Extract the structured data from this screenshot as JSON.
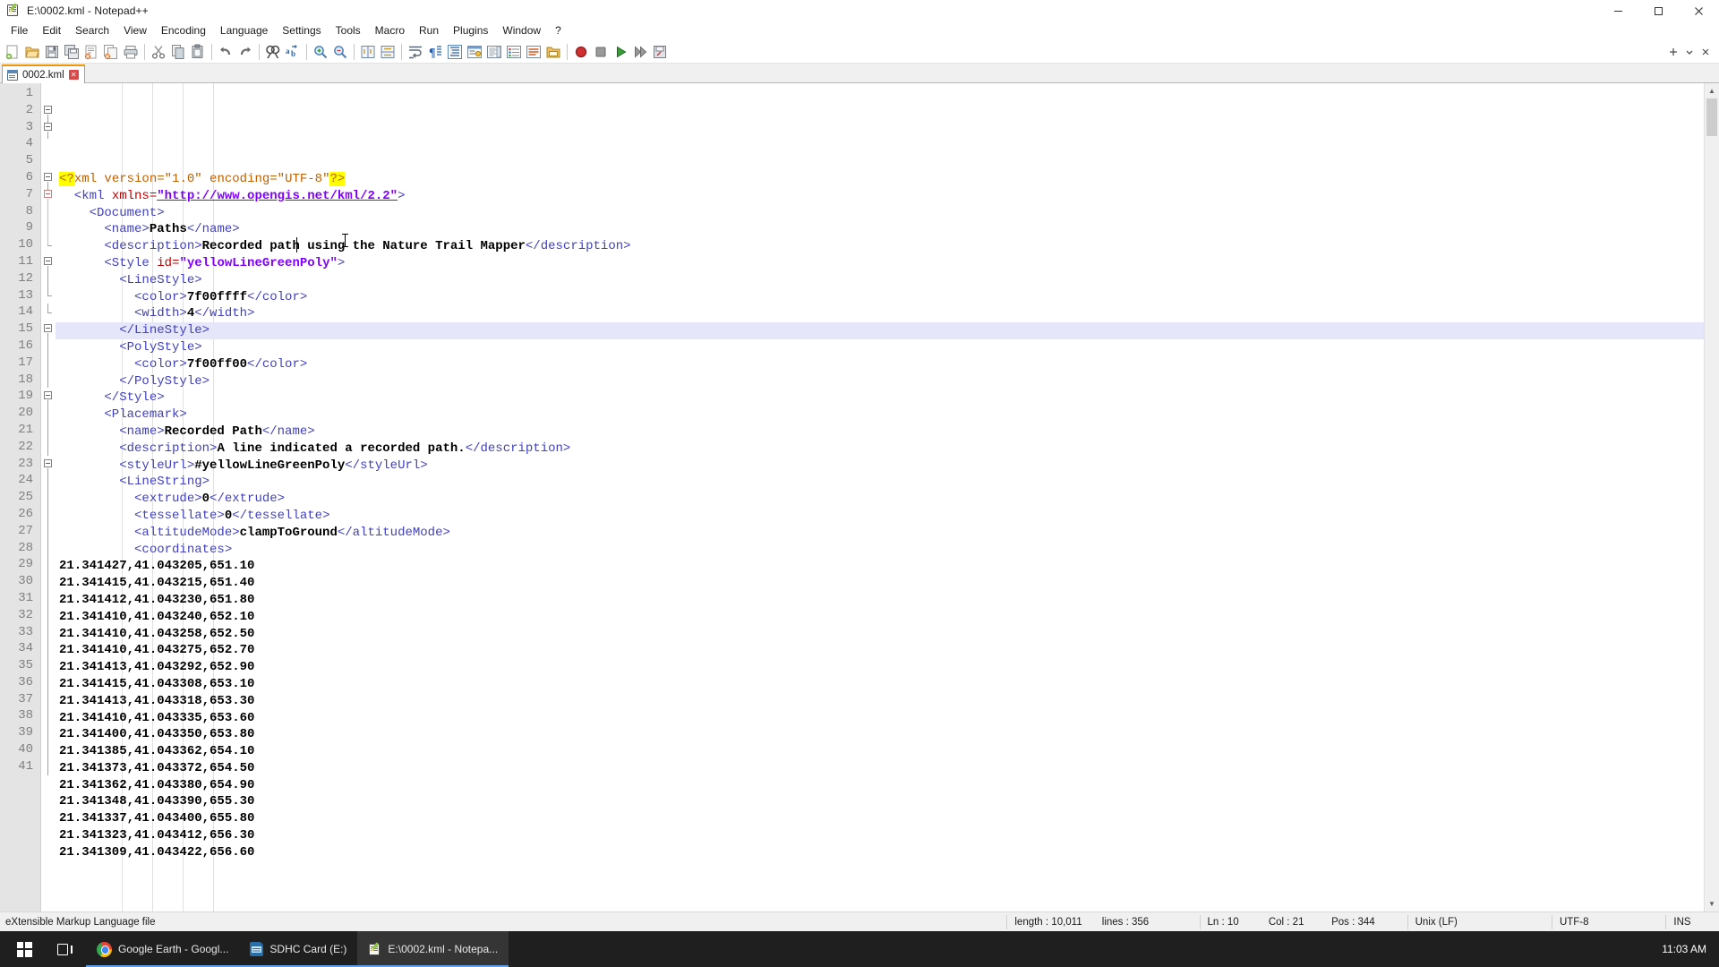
{
  "window": {
    "title": "E:\\0002.kml - Notepad++",
    "icon": "notepad-plus-plus-icon",
    "minimize": "–",
    "maximize": "▢",
    "close": "✕"
  },
  "menubar": {
    "items": [
      {
        "label": "File"
      },
      {
        "label": "Edit"
      },
      {
        "label": "Search"
      },
      {
        "label": "View"
      },
      {
        "label": "Encoding"
      },
      {
        "label": "Language"
      },
      {
        "label": "Settings"
      },
      {
        "label": "Tools"
      },
      {
        "label": "Macro"
      },
      {
        "label": "Run"
      },
      {
        "label": "Plugins"
      },
      {
        "label": "Window"
      },
      {
        "label": "?"
      }
    ]
  },
  "toolbar": {
    "buttons": [
      {
        "name": "new-file-icon",
        "glyph": "new"
      },
      {
        "name": "open-file-icon",
        "glyph": "open"
      },
      {
        "name": "save-icon",
        "glyph": "save"
      },
      {
        "name": "save-all-icon",
        "glyph": "saveall"
      },
      {
        "name": "close-file-icon",
        "glyph": "closefile"
      },
      {
        "name": "close-all-files-icon",
        "glyph": "closeall"
      },
      {
        "name": "print-icon",
        "glyph": "print"
      },
      {
        "name": "separator",
        "glyph": "sep"
      },
      {
        "name": "cut-icon",
        "glyph": "cut"
      },
      {
        "name": "copy-icon",
        "glyph": "copy"
      },
      {
        "name": "paste-icon",
        "glyph": "paste"
      },
      {
        "name": "separator",
        "glyph": "sep"
      },
      {
        "name": "undo-icon",
        "glyph": "undo"
      },
      {
        "name": "redo-icon",
        "glyph": "redo"
      },
      {
        "name": "separator",
        "glyph": "sep"
      },
      {
        "name": "find-icon",
        "glyph": "find"
      },
      {
        "name": "replace-icon",
        "glyph": "replace"
      },
      {
        "name": "separator",
        "glyph": "sep"
      },
      {
        "name": "zoom-in-icon",
        "glyph": "zoomin"
      },
      {
        "name": "zoom-out-icon",
        "glyph": "zoomout"
      },
      {
        "name": "separator",
        "glyph": "sep"
      },
      {
        "name": "sync-vertical-scroll-icon",
        "glyph": "syncv"
      },
      {
        "name": "sync-horizontal-scroll-icon",
        "glyph": "synch"
      },
      {
        "name": "separator",
        "glyph": "sep"
      },
      {
        "name": "word-wrap-icon",
        "glyph": "wrap"
      },
      {
        "name": "show-all-characters-icon",
        "glyph": "allchars"
      },
      {
        "name": "indent-guide-icon",
        "glyph": "indentguide"
      },
      {
        "name": "user-defined-dialog-icon",
        "glyph": "userdlg"
      },
      {
        "name": "document-map-icon",
        "glyph": "docmap"
      },
      {
        "name": "function-list-icon",
        "glyph": "funclist"
      },
      {
        "name": "document-list-icon",
        "glyph": "doclist"
      },
      {
        "name": "folder-as-workspace-icon",
        "glyph": "folderws"
      },
      {
        "name": "separator",
        "glyph": "sep"
      },
      {
        "name": "record-macro-icon",
        "glyph": "record"
      },
      {
        "name": "stop-macro-icon",
        "glyph": "stop"
      },
      {
        "name": "play-macro-icon",
        "glyph": "play"
      },
      {
        "name": "run-macro-multiple-icon",
        "glyph": "playmulti"
      },
      {
        "name": "save-macro-icon",
        "glyph": "savemacro"
      }
    ],
    "right_buttons": [
      {
        "name": "add-tab-icon",
        "glyph": "plus"
      },
      {
        "name": "overflow-chevron-icon",
        "glyph": "chevron"
      },
      {
        "name": "panel-close-icon",
        "glyph": "x"
      }
    ]
  },
  "tabs": [
    {
      "label": "0002.kml",
      "close": "✕",
      "active": true
    }
  ],
  "editor": {
    "current_line": 10,
    "lines": [
      {
        "n": 1,
        "fold": "none",
        "tokens": [
          {
            "t": "<?",
            "c": "hl"
          },
          {
            "t": "xml ",
            "c": "pi"
          },
          {
            "t": "version=",
            "c": "pi"
          },
          {
            "t": "\"1.0\"",
            "c": "pi"
          },
          {
            "t": " encoding=",
            "c": "pi"
          },
          {
            "t": "\"UTF-8\"",
            "c": "pi"
          },
          {
            "t": "?>",
            "c": "hl"
          }
        ],
        "indent": 0
      },
      {
        "n": 2,
        "fold": "open",
        "tokens": [
          {
            "t": "  <kml ",
            "c": "tg"
          },
          {
            "t": "xmlns=",
            "c": "attr"
          },
          {
            "t": "\"http://www.opengis.net/kml/2.2\"",
            "c": "link"
          },
          {
            "t": ">",
            "c": "tg"
          }
        ],
        "indent": 0
      },
      {
        "n": 3,
        "fold": "open",
        "tokens": [
          {
            "t": "    <Document>",
            "c": "tg"
          }
        ],
        "indent": 1
      },
      {
        "n": 4,
        "fold": "none",
        "tokens": [
          {
            "t": "      <name>",
            "c": "tg"
          },
          {
            "t": "Paths",
            "c": "txt"
          },
          {
            "t": "</name>",
            "c": "tg"
          }
        ],
        "indent": 2
      },
      {
        "n": 5,
        "fold": "none",
        "tokens": [
          {
            "t": "      <description>",
            "c": "tg"
          },
          {
            "t": "Recorded path using the Nature Trail Mapper",
            "c": "txt"
          },
          {
            "t": "</description>",
            "c": "tg"
          }
        ],
        "indent": 2
      },
      {
        "n": 6,
        "fold": "open",
        "tokens": [
          {
            "t": "      <Style ",
            "c": "tg"
          },
          {
            "t": "id=",
            "c": "attr"
          },
          {
            "t": "\"yellowLineGreenPoly\"",
            "c": "val"
          },
          {
            "t": ">",
            "c": "tg"
          }
        ],
        "indent": 2
      },
      {
        "n": 7,
        "fold": "open-red",
        "tokens": [
          {
            "t": "        <LineStyle>",
            "c": "tg"
          }
        ],
        "indent": 3
      },
      {
        "n": 8,
        "fold": "bar-red",
        "tokens": [
          {
            "t": "          <color>",
            "c": "tg"
          },
          {
            "t": "7f00ffff",
            "c": "txt"
          },
          {
            "t": "</color>",
            "c": "tg"
          }
        ],
        "indent": 4
      },
      {
        "n": 9,
        "fold": "bar-red",
        "tokens": [
          {
            "t": "          <width>",
            "c": "tg"
          },
          {
            "t": "4",
            "c": "txt"
          },
          {
            "t": "</width>",
            "c": "tg"
          }
        ],
        "indent": 4
      },
      {
        "n": 10,
        "fold": "end-red",
        "tokens": [
          {
            "t": "        </LineStyle>",
            "c": "tg"
          }
        ],
        "indent": 3
      },
      {
        "n": 11,
        "fold": "open",
        "tokens": [
          {
            "t": "        <PolyStyle>",
            "c": "tg"
          }
        ],
        "indent": 3
      },
      {
        "n": 12,
        "fold": "bar",
        "tokens": [
          {
            "t": "          <color>",
            "c": "tg"
          },
          {
            "t": "7f00ff00",
            "c": "txt"
          },
          {
            "t": "</color>",
            "c": "tg"
          }
        ],
        "indent": 4
      },
      {
        "n": 13,
        "fold": "end",
        "tokens": [
          {
            "t": "        </PolyStyle>",
            "c": "tg"
          }
        ],
        "indent": 3
      },
      {
        "n": 14,
        "fold": "end",
        "tokens": [
          {
            "t": "      </Style>",
            "c": "tg"
          }
        ],
        "indent": 2
      },
      {
        "n": 15,
        "fold": "open",
        "tokens": [
          {
            "t": "      <Placemark>",
            "c": "tg"
          }
        ],
        "indent": 2
      },
      {
        "n": 16,
        "fold": "bar",
        "tokens": [
          {
            "t": "        <name>",
            "c": "tg"
          },
          {
            "t": "Recorded Path",
            "c": "txt"
          },
          {
            "t": "</name>",
            "c": "tg"
          }
        ],
        "indent": 3
      },
      {
        "n": 17,
        "fold": "bar",
        "tokens": [
          {
            "t": "        <description>",
            "c": "tg"
          },
          {
            "t": "A line indicated a recorded path.",
            "c": "txt"
          },
          {
            "t": "</description>",
            "c": "tg"
          }
        ],
        "indent": 3
      },
      {
        "n": 18,
        "fold": "bar",
        "tokens": [
          {
            "t": "        <styleUrl>",
            "c": "tg"
          },
          {
            "t": "#yellowLineGreenPoly",
            "c": "txt"
          },
          {
            "t": "</styleUrl>",
            "c": "tg"
          }
        ],
        "indent": 3
      },
      {
        "n": 19,
        "fold": "open",
        "tokens": [
          {
            "t": "        <LineString>",
            "c": "tg"
          }
        ],
        "indent": 3
      },
      {
        "n": 20,
        "fold": "bar",
        "tokens": [
          {
            "t": "          <extrude>",
            "c": "tg"
          },
          {
            "t": "0",
            "c": "txt"
          },
          {
            "t": "</extrude>",
            "c": "tg"
          }
        ],
        "indent": 4
      },
      {
        "n": 21,
        "fold": "bar",
        "tokens": [
          {
            "t": "          <tessellate>",
            "c": "tg"
          },
          {
            "t": "0",
            "c": "txt"
          },
          {
            "t": "</tessellate>",
            "c": "tg"
          }
        ],
        "indent": 4
      },
      {
        "n": 22,
        "fold": "bar",
        "tokens": [
          {
            "t": "          <altitudeMode>",
            "c": "tg"
          },
          {
            "t": "clampToGround",
            "c": "txt"
          },
          {
            "t": "</altitudeMode>",
            "c": "tg"
          }
        ],
        "indent": 4
      },
      {
        "n": 23,
        "fold": "open",
        "tokens": [
          {
            "t": "          <coordinates>",
            "c": "tg"
          }
        ],
        "indent": 4
      },
      {
        "n": 24,
        "fold": "bar",
        "tokens": [
          {
            "t": "21.341427,41.043205,651.10",
            "c": "coord"
          }
        ],
        "indent": 0
      },
      {
        "n": 25,
        "fold": "bar",
        "tokens": [
          {
            "t": "21.341415,41.043215,651.40",
            "c": "coord"
          }
        ],
        "indent": 0
      },
      {
        "n": 26,
        "fold": "bar",
        "tokens": [
          {
            "t": "21.341412,41.043230,651.80",
            "c": "coord"
          }
        ],
        "indent": 0
      },
      {
        "n": 27,
        "fold": "bar",
        "tokens": [
          {
            "t": "21.341410,41.043240,652.10",
            "c": "coord"
          }
        ],
        "indent": 0
      },
      {
        "n": 28,
        "fold": "bar",
        "tokens": [
          {
            "t": "21.341410,41.043258,652.50",
            "c": "coord"
          }
        ],
        "indent": 0
      },
      {
        "n": 29,
        "fold": "bar",
        "tokens": [
          {
            "t": "21.341410,41.043275,652.70",
            "c": "coord"
          }
        ],
        "indent": 0
      },
      {
        "n": 30,
        "fold": "bar",
        "tokens": [
          {
            "t": "21.341413,41.043292,652.90",
            "c": "coord"
          }
        ],
        "indent": 0
      },
      {
        "n": 31,
        "fold": "bar",
        "tokens": [
          {
            "t": "21.341415,41.043308,653.10",
            "c": "coord"
          }
        ],
        "indent": 0
      },
      {
        "n": 32,
        "fold": "bar",
        "tokens": [
          {
            "t": "21.341413,41.043318,653.30",
            "c": "coord"
          }
        ],
        "indent": 0
      },
      {
        "n": 33,
        "fold": "bar",
        "tokens": [
          {
            "t": "21.341410,41.043335,653.60",
            "c": "coord"
          }
        ],
        "indent": 0
      },
      {
        "n": 34,
        "fold": "bar",
        "tokens": [
          {
            "t": "21.341400,41.043350,653.80",
            "c": "coord"
          }
        ],
        "indent": 0
      },
      {
        "n": 35,
        "fold": "bar",
        "tokens": [
          {
            "t": "21.341385,41.043362,654.10",
            "c": "coord"
          }
        ],
        "indent": 0
      },
      {
        "n": 36,
        "fold": "bar",
        "tokens": [
          {
            "t": "21.341373,41.043372,654.50",
            "c": "coord"
          }
        ],
        "indent": 0
      },
      {
        "n": 37,
        "fold": "bar",
        "tokens": [
          {
            "t": "21.341362,41.043380,654.90",
            "c": "coord"
          }
        ],
        "indent": 0
      },
      {
        "n": 38,
        "fold": "bar",
        "tokens": [
          {
            "t": "21.341348,41.043390,655.30",
            "c": "coord"
          }
        ],
        "indent": 0
      },
      {
        "n": 39,
        "fold": "bar",
        "tokens": [
          {
            "t": "21.341337,41.043400,655.80",
            "c": "coord"
          }
        ],
        "indent": 0
      },
      {
        "n": 40,
        "fold": "bar",
        "tokens": [
          {
            "t": "21.341323,41.043412,656.30",
            "c": "coord"
          }
        ],
        "indent": 0
      },
      {
        "n": 41,
        "fold": "bar",
        "tokens": [
          {
            "t": "21.341309,41.043422,656.60",
            "c": "coord"
          }
        ],
        "indent": 0
      }
    ]
  },
  "statusbar": {
    "description": "eXtensible Markup Language file",
    "length": "length : 10,011",
    "lines": "lines : 356",
    "ln": "Ln : 10",
    "col": "Col : 21",
    "pos": "Pos : 344",
    "eol": "Unix (LF)",
    "encoding": "UTF-8",
    "insert_mode": "INS"
  },
  "taskbar": {
    "start": "start-button",
    "task_view": "task-view-button",
    "apps": [
      {
        "label": "Google Earth - Googl...",
        "icon": "chrome-icon"
      },
      {
        "label": "SDHC Card (E:)",
        "icon": "sd-card-icon"
      },
      {
        "label": "E:\\0002.kml - Notepa...",
        "icon": "notepad-plus-plus-icon",
        "active": true
      }
    ],
    "clock": "11:03 AM"
  },
  "colors": {
    "tag": "#4040c0",
    "attribute": "#c00000",
    "value": "#8000ff",
    "text": "#000000",
    "highlight": "#ffff00",
    "current_line": "#e6e6fa",
    "tab_accent": "#f09609"
  }
}
